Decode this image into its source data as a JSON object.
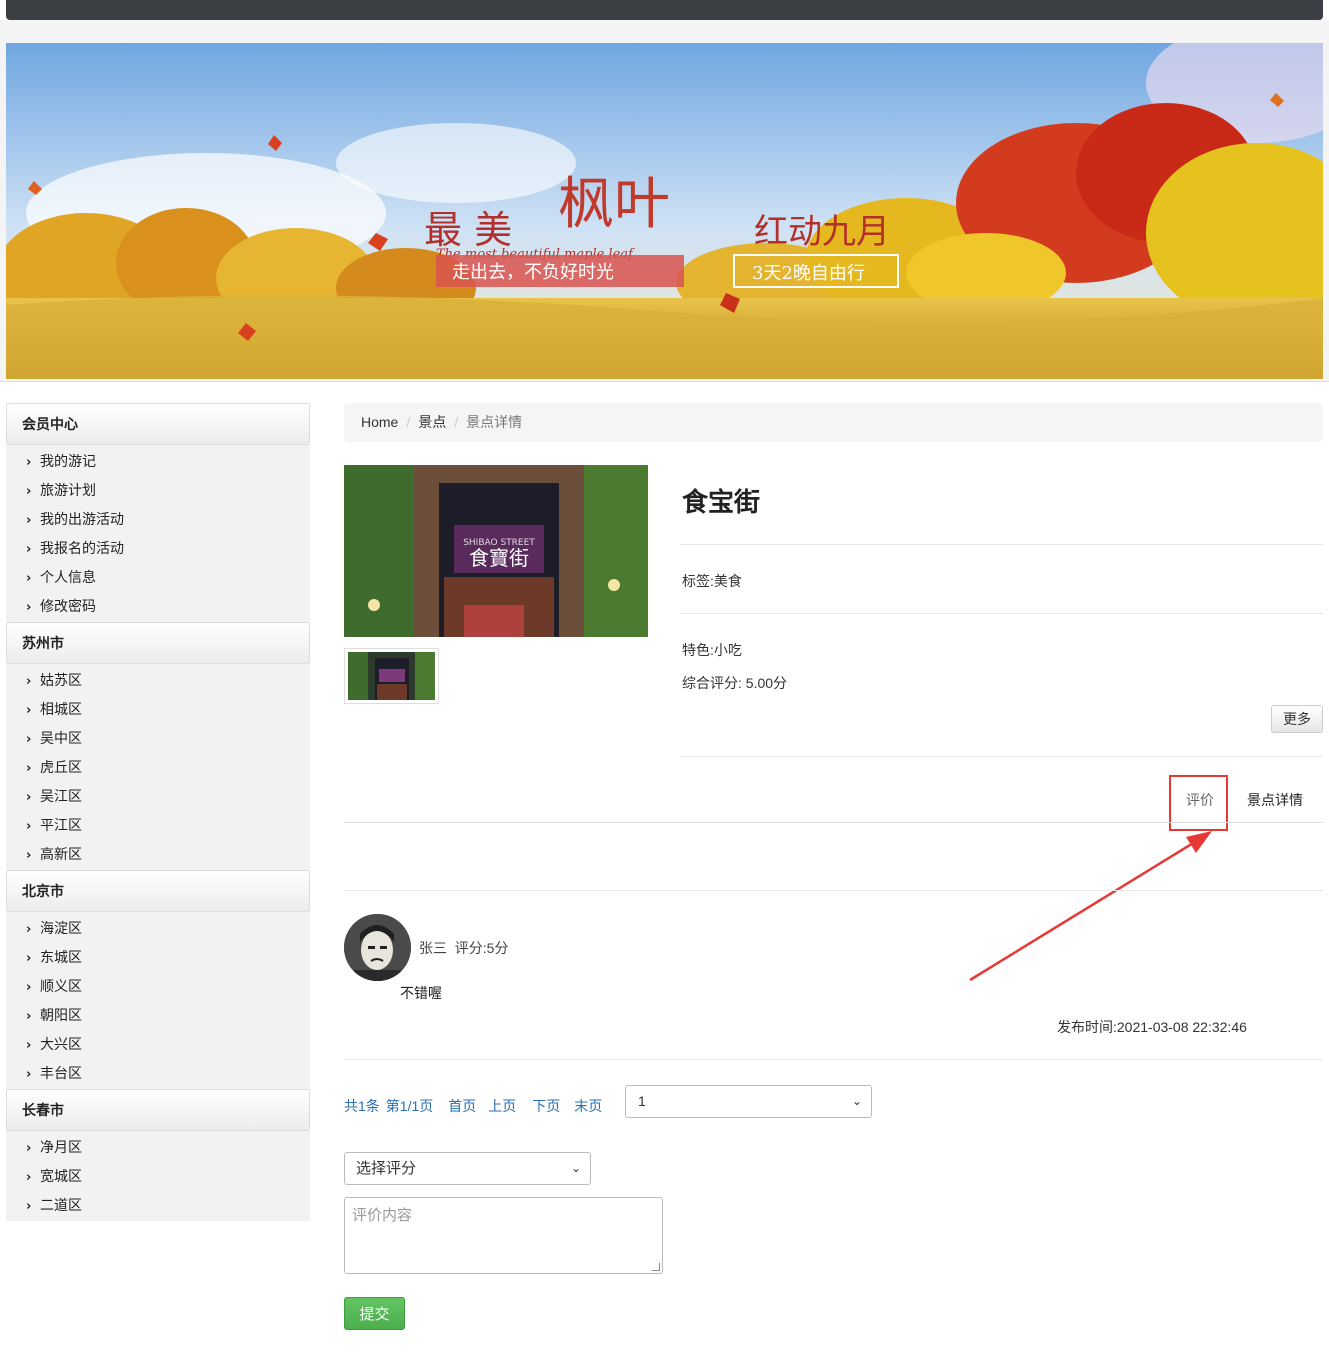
{
  "banner": {
    "headline_1": "最 美",
    "headline_2": "枫叶",
    "headline_3": "红动九月",
    "subtitle_en": "The most beautiful maple leaf",
    "slogan": "走出去，不负好时光",
    "tour": "3天2晚自由行"
  },
  "sidebar": {
    "groups": [
      {
        "title": "会员中心",
        "items": [
          "我的游记",
          "旅游计划",
          "我的出游活动",
          "我报名的活动",
          "个人信息",
          "修改密码"
        ]
      },
      {
        "title": "苏州市",
        "items": [
          "姑苏区",
          "相城区",
          "吴中区",
          "虎丘区",
          "吴江区",
          "平江区",
          "高新区"
        ]
      },
      {
        "title": "北京市",
        "items": [
          "海淀区",
          "东城区",
          "顺义区",
          "朝阳区",
          "大兴区",
          "丰台区"
        ]
      },
      {
        "title": "长春市",
        "items": [
          "净月区",
          "宽城区",
          "二道区"
        ]
      }
    ]
  },
  "breadcrumb": {
    "home": "Home",
    "section": "景点",
    "current": "景点详情",
    "sep": "/"
  },
  "attraction": {
    "sign_text": "食寶街",
    "sign_en": "SHIBAO STREET",
    "name": "食宝街",
    "tag": "标签:美食",
    "feature": "特色:小吃",
    "rating": "综合评分: 5.00分",
    "more_label": "更多"
  },
  "tabs": {
    "eval": "评价",
    "detail": "景点详情"
  },
  "review": {
    "user": "张三",
    "score": "评分:5分",
    "content": "不错喔",
    "time": "发布时间:2021-03-08 22:32:46"
  },
  "pager": {
    "total": "共1条",
    "page": "第1/1页",
    "first": "首页",
    "prev": "上页",
    "next": "下页",
    "last": "末页",
    "selected_page": "1"
  },
  "form": {
    "rating_placeholder": "选择评分",
    "content_placeholder": "评价内容",
    "submit_label": "提交"
  },
  "colors": {
    "link": "#2a6fb3",
    "highlight": "#e53935",
    "submit": "#5cb85c",
    "topbar": "#3b3e43"
  }
}
